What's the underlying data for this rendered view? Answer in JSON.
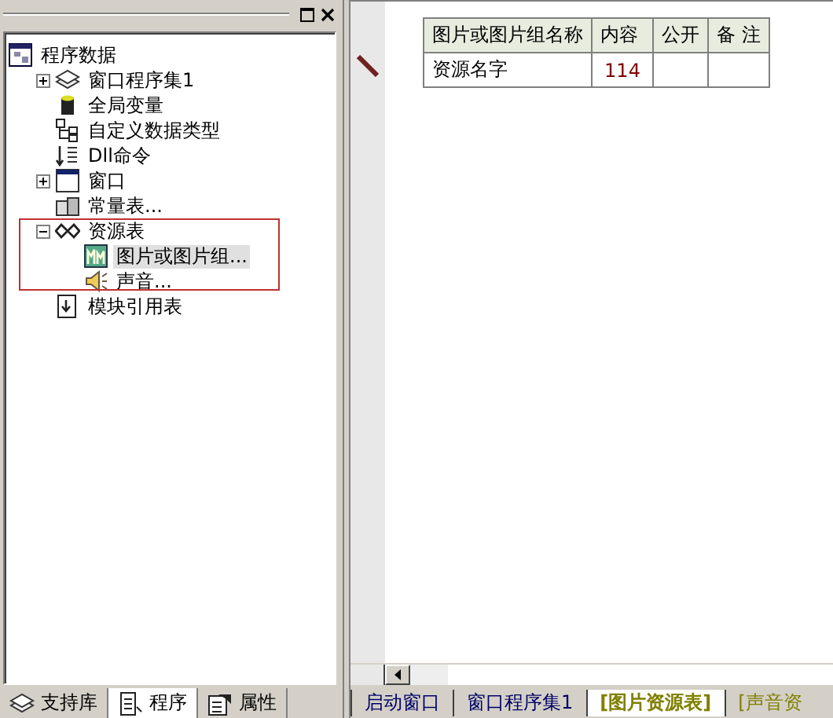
{
  "tree": {
    "label": "程序数据",
    "kind": "root",
    "selected": false,
    "children": [
      {
        "label": "窗口程序集1",
        "kind": "assembly",
        "expanded": false,
        "selected": false
      },
      {
        "label": "全局变量",
        "kind": "variable",
        "selected": false
      },
      {
        "label": "自定义数据类型",
        "kind": "type",
        "selected": false
      },
      {
        "label": "Dll命令",
        "kind": "dll",
        "selected": false
      },
      {
        "label": "窗口",
        "kind": "window",
        "expanded": false,
        "selected": false
      },
      {
        "label": "常量表...",
        "kind": "constant",
        "selected": false
      },
      {
        "label": "资源表",
        "kind": "resource",
        "expanded": true,
        "selected": false,
        "children": [
          {
            "label": "图片或图片组...",
            "kind": "picture",
            "selected": true
          },
          {
            "label": "声音...",
            "kind": "sound",
            "selected": false
          }
        ]
      },
      {
        "label": "模块引用表",
        "kind": "module",
        "selected": false
      }
    ]
  },
  "panel_tabs": [
    {
      "label": "支持库",
      "kind": "library",
      "selected": false
    },
    {
      "label": "程序",
      "kind": "program",
      "selected": true
    },
    {
      "label": "属性",
      "kind": "property",
      "selected": false
    }
  ],
  "table": {
    "columns": [
      "图片或图片组名称",
      "内容",
      "公开",
      "备 注"
    ],
    "rows": [
      [
        "资源名字",
        "114",
        "",
        ""
      ]
    ]
  },
  "doc_tabs": [
    {
      "label": "启动窗口",
      "selected": false,
      "kind": "page"
    },
    {
      "label": "窗口程序集1",
      "selected": false,
      "kind": "page"
    },
    {
      "label": "[图片资源表]",
      "selected": true,
      "kind": "resource"
    },
    {
      "label": "[声音资",
      "selected": false,
      "kind": "resource"
    }
  ]
}
